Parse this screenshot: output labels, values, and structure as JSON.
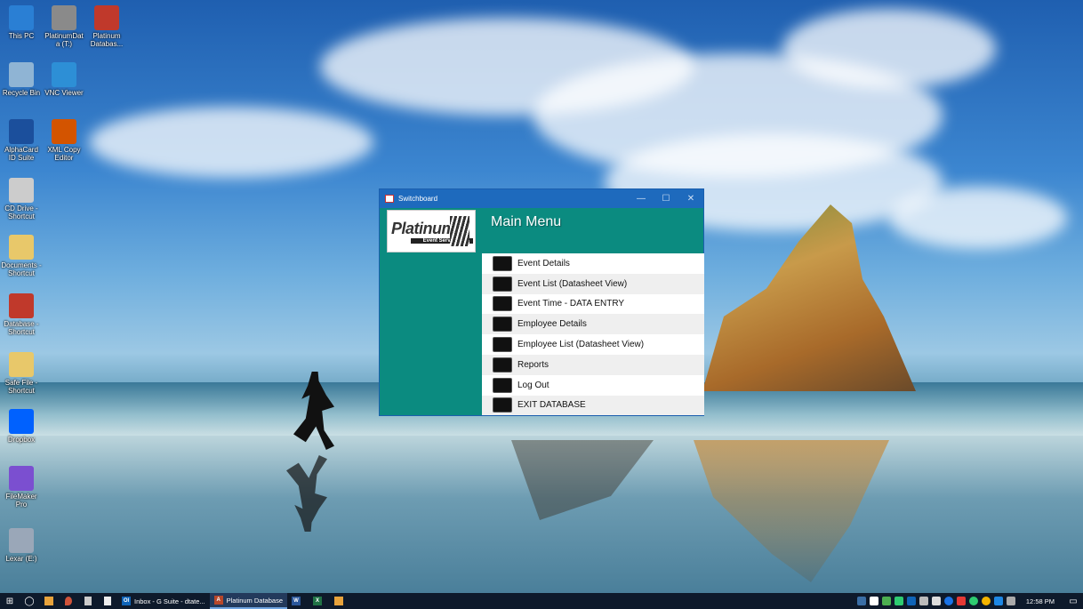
{
  "desktop_icons": [
    {
      "label": "This PC",
      "icon": "monitor-icon",
      "color": "#2a7fd4"
    },
    {
      "label": "PlatinumData (T:)",
      "icon": "network-drive-icon",
      "color": "#8a8a8a"
    },
    {
      "label": "Platinum Databas...",
      "icon": "access-file-icon",
      "color": "#c0392b"
    },
    {
      "label": "Recycle Bin",
      "icon": "recycle-bin-icon",
      "color": "#8fb4d4"
    },
    {
      "label": "VNC Viewer",
      "icon": "vnc-icon",
      "color": "#2d8fd6"
    },
    {
      "label": "AlphaCard ID Suite",
      "icon": "id-card-icon",
      "color": "#1b4f9c"
    },
    {
      "label": "XML Copy Editor",
      "icon": "xml-editor-icon",
      "color": "#d35400"
    },
    {
      "label": "CD Drive - Shortcut",
      "icon": "dvd-icon",
      "color": "#cccccc"
    },
    {
      "label": "Documents - Shortcut",
      "icon": "documents-icon",
      "color": "#e8c86a"
    },
    {
      "label": "Database - Shortcut",
      "icon": "database-file-icon",
      "color": "#c0392b"
    },
    {
      "label": "Safe File - Shortcut",
      "icon": "folder-icon",
      "color": "#e8c86a"
    },
    {
      "label": "Dropbox",
      "icon": "dropbox-icon",
      "color": "#0061fe"
    },
    {
      "label": "FileMaker Pro",
      "icon": "filemaker-icon",
      "color": "#7b4fd0"
    },
    {
      "label": "Lexar (E:)",
      "icon": "usb-drive-icon",
      "color": "#9aa7b8"
    }
  ],
  "window": {
    "title": "Switchboard",
    "minimize": "—",
    "maximize": "☐",
    "close": "✕",
    "logo_brand": "Platinum",
    "logo_sub": "Event Services",
    "heading": "Main Menu",
    "accent": "#0b8b80",
    "menu_items": [
      {
        "label": "Event Details"
      },
      {
        "label": "Event List (Datasheet View)"
      },
      {
        "label": "Event Time - DATA ENTRY"
      },
      {
        "label": "Employee Details"
      },
      {
        "label": "Employee List (Datasheet View)"
      },
      {
        "label": "Reports"
      },
      {
        "label": "Log Out"
      },
      {
        "label": "EXIT DATABASE"
      }
    ]
  },
  "taskbar": {
    "apps": [
      {
        "label": "Inbox - G Suite - dtate...",
        "badge": "Ol",
        "color": "#0f64b8"
      },
      {
        "label": "Platinum Database",
        "badge": "A",
        "color": "#b7472a",
        "active": true
      }
    ],
    "pinned": [
      {
        "badge": "W",
        "color": "#2b579a"
      },
      {
        "badge": "X",
        "color": "#217346"
      },
      {
        "badge": "",
        "color": "#e8a33c"
      }
    ],
    "clock": "12:58 PM"
  }
}
